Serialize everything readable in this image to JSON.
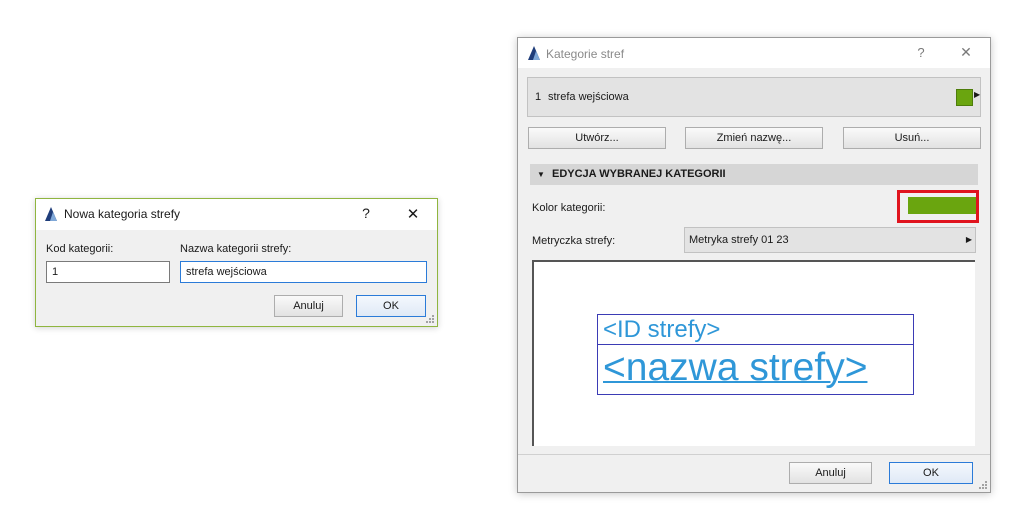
{
  "dialog_new": {
    "title": "Nowa kategoria strefy",
    "help": "?",
    "close": "✕",
    "code_label": "Kod kategorii:",
    "code_value": "1",
    "name_label": "Nazwa kategorii strefy:",
    "name_value": "strefa wejściowa",
    "cancel": "Anuluj",
    "ok": "OK"
  },
  "dialog_categories": {
    "title": "Kategorie stref",
    "help": "?",
    "close": "✕",
    "selected_item": {
      "id": "1",
      "name": "strefa wejściowa",
      "color": "#6aa50f"
    },
    "buttons": {
      "create": "Utwórz...",
      "rename": "Zmień nazwę...",
      "delete": "Usuń..."
    },
    "section_title": "EDYCJA WYBRANEJ KATEGORII",
    "color_label": "Kolor kategorii:",
    "category_color": "#6aa50f",
    "highlight_color": "#e0141e",
    "stamp_label": "Metryczka strefy:",
    "stamp_value": "Metryka strefy 01 23",
    "preview": {
      "id_text": "<ID strefy>",
      "name_text": "<nazwa strefy>"
    },
    "cancel": "Anuluj",
    "ok": "OK"
  }
}
